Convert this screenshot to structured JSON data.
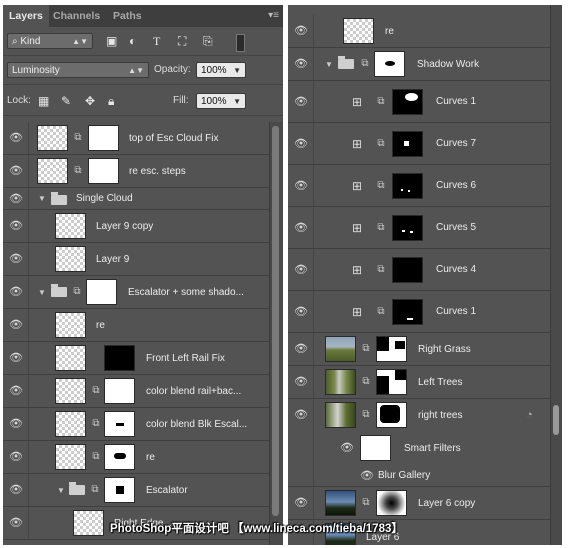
{
  "left": {
    "tabs": [
      "Layers",
      "Channels",
      "Paths"
    ],
    "filter_kind": "Kind",
    "blend_mode": "Luminosity",
    "opacity_label": "Opacity:",
    "opacity_value": "100%",
    "lock_label": "Lock:",
    "fill_label": "Fill:",
    "fill_value": "100%",
    "layers": [
      "top of Esc Cloud Fix",
      "re esc. steps",
      "Single Cloud",
      "Layer 9 copy",
      "Layer 9",
      "Escalator + some shado...",
      "re",
      "Front Left Rail Fix",
      "color blend rail+bac...",
      "color blend Blk Escal...",
      "re",
      "Escalator",
      "Right Edge..."
    ]
  },
  "right": {
    "layers": [
      "re",
      "Shadow Work",
      "Curves 1",
      "Curves 7",
      "Curves 6",
      "Curves 5",
      "Curves 4",
      "Curves 1",
      "Right Grass",
      "Left Trees",
      "right trees",
      "Smart Filters",
      "Blur Gallery",
      "Layer 6 copy",
      "Layer 6"
    ]
  },
  "watermark": "PhotoShop平面设计吧 【www.lineca.com/tieba/1783】",
  "colors": {
    "panel": "#535353",
    "tabbar": "#3e3e3e",
    "row_border": "#3f3f3f"
  }
}
